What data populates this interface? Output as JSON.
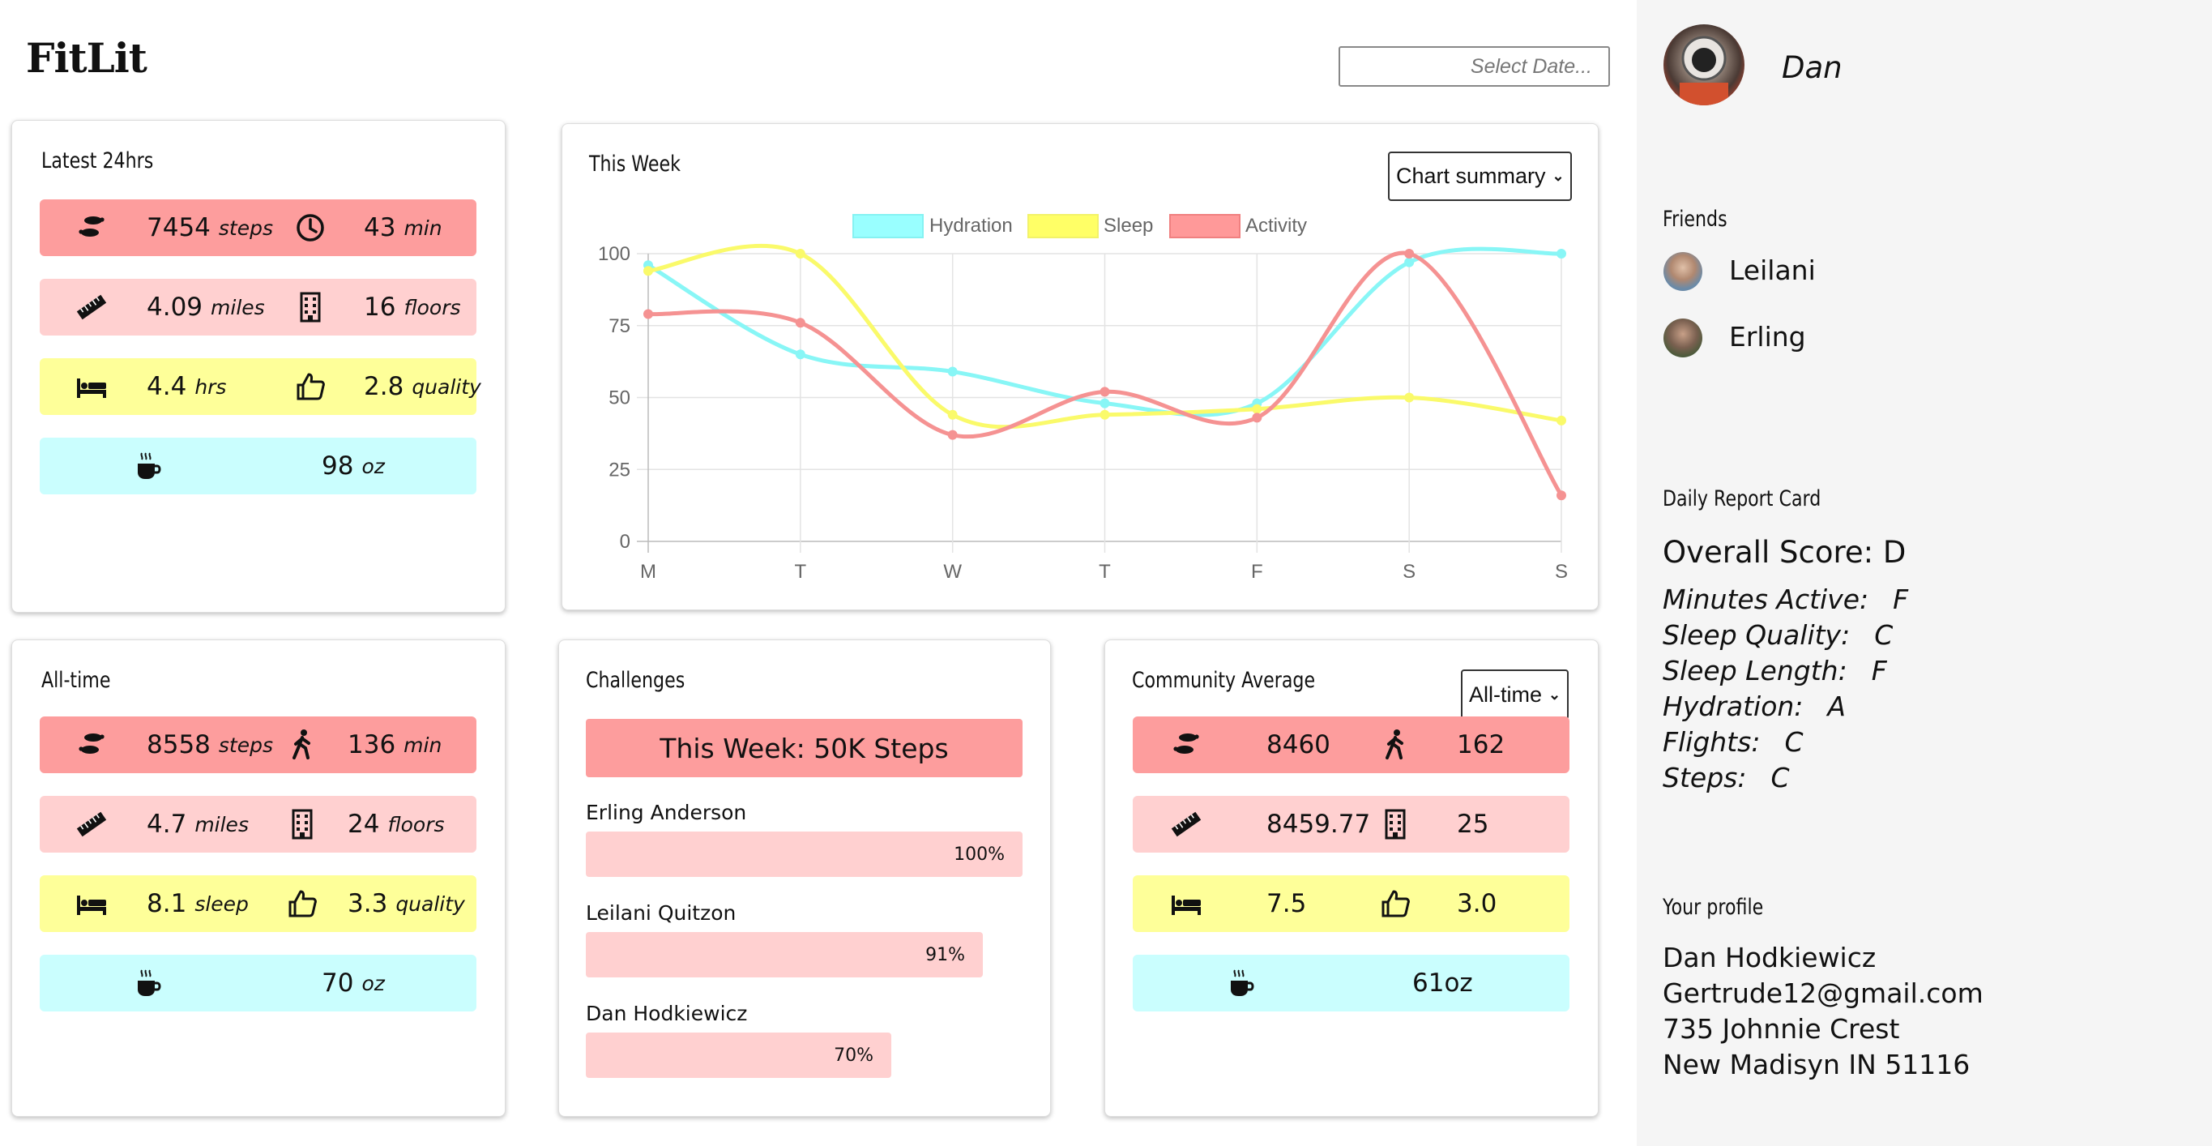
{
  "app": {
    "title": "FitLit",
    "date_placeholder": "Select Date..."
  },
  "latest": {
    "title": "Latest 24hrs",
    "rows": [
      {
        "color": "red",
        "a_icon": "footprints-icon",
        "a_num": "7454",
        "a_unit": "steps",
        "b_icon": "clock-icon",
        "b_num": "43",
        "b_unit": "min"
      },
      {
        "color": "pink",
        "a_icon": "ruler-icon",
        "a_num": "4.09",
        "a_unit": "miles",
        "b_icon": "building-icon",
        "b_num": "16",
        "b_unit": "floors"
      },
      {
        "color": "yellow",
        "a_icon": "bed-icon",
        "a_num": "4.4",
        "a_unit": "hrs",
        "b_icon": "thumbs-up-icon",
        "b_num": "2.8",
        "b_unit": "quality"
      },
      {
        "color": "cyan",
        "a_icon": "coffee-icon",
        "a_num": "98",
        "a_unit": "oz"
      }
    ]
  },
  "week": {
    "title": "This Week",
    "select_value": "Chart summary",
    "legend": [
      {
        "name": "Hydration",
        "fill": "#99ffff",
        "stroke": "#85f2f2"
      },
      {
        "name": "Sleep",
        "fill": "#ffff66",
        "stroke": "#f2f26a"
      },
      {
        "name": "Activity",
        "fill": "#ff9999",
        "stroke": "#f08080"
      }
    ]
  },
  "chart_data": {
    "type": "line",
    "title": "This Week",
    "categories": [
      "M",
      "T",
      "W",
      "T",
      "F",
      "S",
      "S"
    ],
    "series": [
      {
        "name": "Hydration",
        "values": [
          96,
          65,
          59,
          48,
          48,
          97,
          100
        ],
        "color": "#88f6f6"
      },
      {
        "name": "Sleep",
        "values": [
          94,
          100,
          44,
          44,
          46,
          50,
          42
        ],
        "color": "#fafa6a"
      },
      {
        "name": "Activity",
        "values": [
          79,
          76,
          37,
          52,
          43,
          100,
          16
        ],
        "color": "#f59292"
      }
    ],
    "ylim": [
      0,
      100
    ],
    "yticks": [
      "0",
      "25",
      "50",
      "75",
      "100"
    ],
    "grid": true,
    "legend": "top"
  },
  "alltime": {
    "title": "All-time",
    "rows": [
      {
        "color": "red",
        "a_icon": "footprints-icon",
        "a_num": "8558",
        "a_unit": "steps",
        "b_icon": "walking-person-icon",
        "b_num": "136",
        "b_unit": "min"
      },
      {
        "color": "pink",
        "a_icon": "ruler-icon",
        "a_num": "4.7",
        "a_unit": "miles",
        "b_icon": "building-icon",
        "b_num": "24",
        "b_unit": "floors"
      },
      {
        "color": "yellow",
        "a_icon": "bed-icon",
        "a_num": "8.1",
        "a_unit": "sleep",
        "b_icon": "thumbs-up-icon",
        "b_num": "3.3",
        "b_unit": "quality"
      },
      {
        "color": "cyan",
        "a_icon": "coffee-icon",
        "a_num": "70",
        "a_unit": "oz"
      }
    ]
  },
  "challenges": {
    "title": "Challenges",
    "banner": "This Week: 50K Steps",
    "participants": [
      {
        "name": "Erling Anderson",
        "pct_label": "100%",
        "progress": 1.0
      },
      {
        "name": "Leilani Quitzon",
        "pct_label": "91%",
        "progress": 0.91
      },
      {
        "name": "Dan Hodkiewicz",
        "pct_label": "70%",
        "progress": 0.7
      }
    ]
  },
  "community": {
    "title": "Community Average",
    "select_value": "All-time",
    "rows": [
      {
        "color": "red",
        "a_icon": "footprints-icon",
        "a_num": "8460",
        "b_icon": "walking-person-icon",
        "b_num": "162"
      },
      {
        "color": "pink",
        "a_icon": "ruler-icon",
        "a_num": "8459.77",
        "b_icon": "building-icon",
        "b_num": "25"
      },
      {
        "color": "yellow",
        "a_icon": "bed-icon",
        "a_num": "7.5",
        "b_icon": "thumbs-up-icon",
        "b_num": "3.0"
      },
      {
        "color": "cyan",
        "a_icon": "coffee-icon",
        "a_num": "61oz"
      }
    ]
  },
  "sidebar": {
    "user_name": "Dan",
    "friends_title": "Friends",
    "friends": [
      "Leilani",
      "Erling"
    ],
    "report": {
      "title": "Daily Report Card",
      "overall": "Overall Score: D",
      "grades": [
        {
          "label": "Minutes Active:",
          "grade": "F"
        },
        {
          "label": "Sleep Quality:",
          "grade": "C"
        },
        {
          "label": "Sleep Length:",
          "grade": "F"
        },
        {
          "label": "Hydration:",
          "grade": "A"
        },
        {
          "label": "Flights:",
          "grade": "C"
        },
        {
          "label": "Steps:",
          "grade": "C"
        }
      ]
    },
    "profile": {
      "title": "Your profile",
      "lines": [
        "Dan Hodkiewicz",
        "Gertrude12@gmail.com",
        "735 Johnnie Crest",
        "New Madisyn IN 51116"
      ]
    }
  }
}
